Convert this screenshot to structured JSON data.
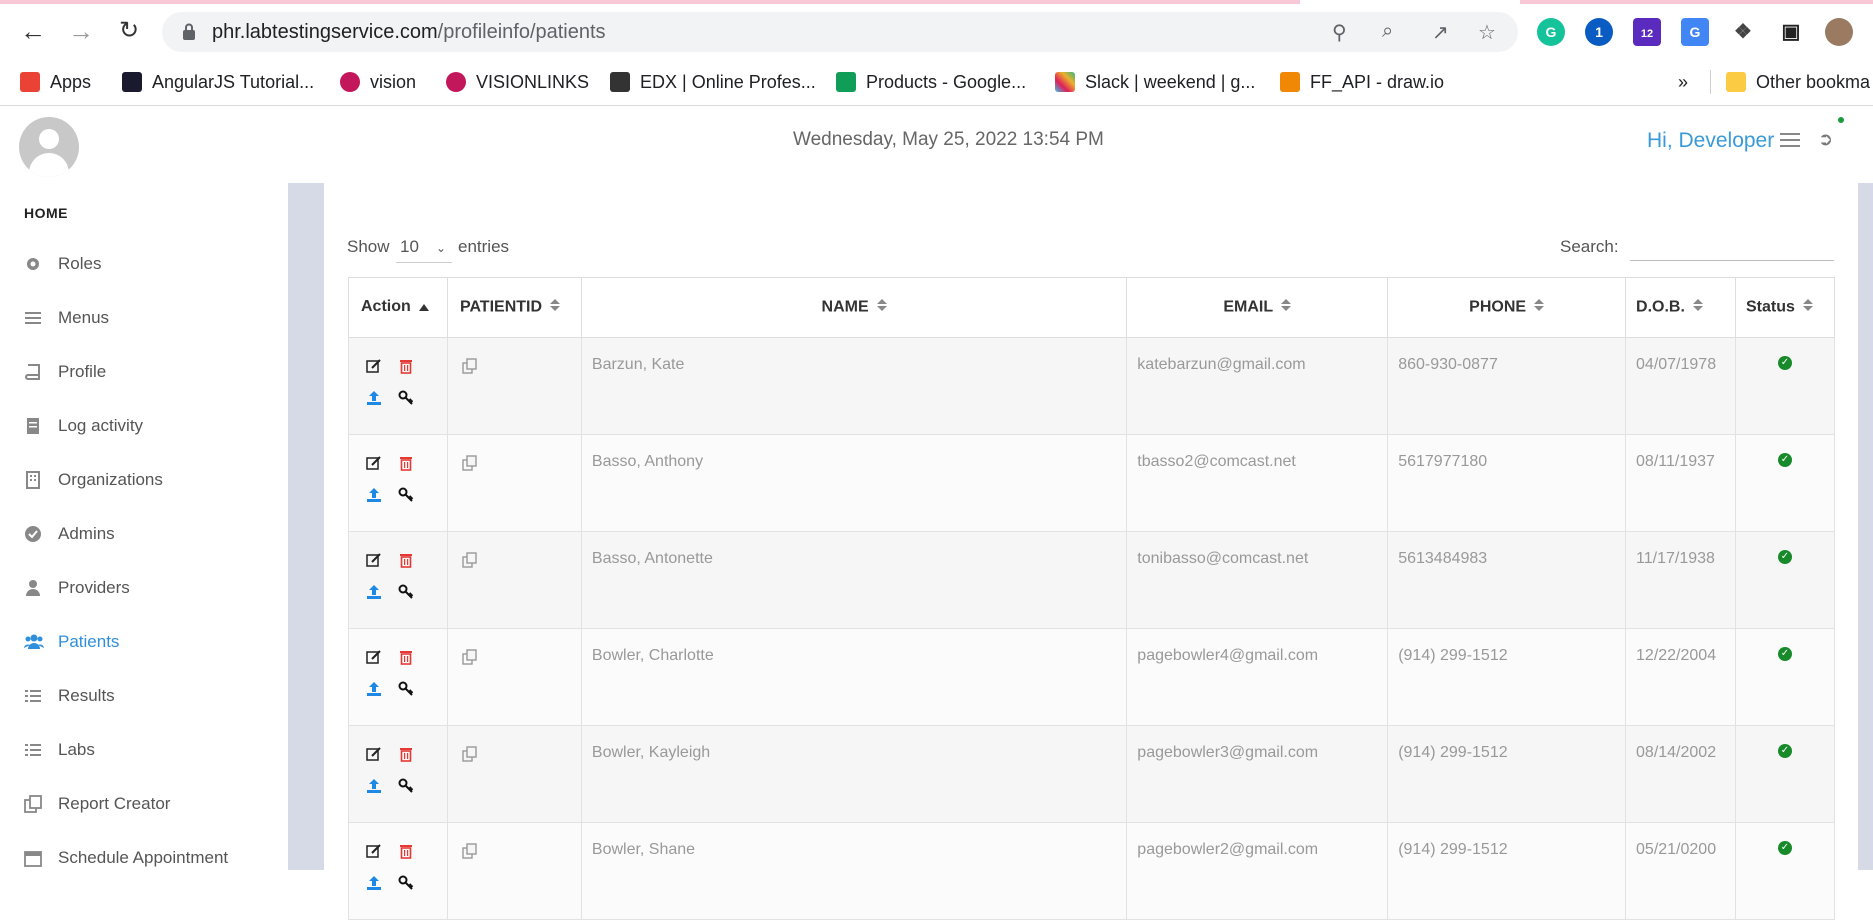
{
  "browser": {
    "url_domain": "phr.labtestingservice.com",
    "url_path": "/profileinfo/patients",
    "extension_badge": "12",
    "bookmarks": [
      {
        "label": "Apps",
        "color": "#ea4335"
      },
      {
        "label": "AngularJS Tutorial...",
        "color": "#1a1a2e"
      },
      {
        "label": "vision",
        "color": "#c2185b"
      },
      {
        "label": "VISIONLINKS",
        "color": "#c2185b"
      },
      {
        "label": "EDX | Online Profes...",
        "color": "#333333"
      },
      {
        "label": "Products - Google...",
        "color": "#0f9d58"
      },
      {
        "label": "Slack | weekend | g...",
        "color": "#4a154b"
      },
      {
        "label": "FF_API - draw.io",
        "color": "#f08705"
      }
    ],
    "more_bookmarks": "»",
    "other_bookmarks": "Other bookma"
  },
  "header": {
    "datetime": "Wednesday, May 25, 2022 13:54 PM",
    "greeting": "Hi, Developer"
  },
  "sidebar": {
    "home_label": "HOME",
    "items": [
      {
        "label": "Roles",
        "icon": "gear-icon"
      },
      {
        "label": "Menus",
        "icon": "menu-icon"
      },
      {
        "label": "Profile",
        "icon": "book-icon"
      },
      {
        "label": "Log activity",
        "icon": "document-icon"
      },
      {
        "label": "Organizations",
        "icon": "building-icon"
      },
      {
        "label": "Admins",
        "icon": "check-circle-icon"
      },
      {
        "label": "Providers",
        "icon": "user-md-icon"
      },
      {
        "label": "Patients",
        "icon": "users-icon",
        "active": true
      },
      {
        "label": "Results",
        "icon": "list-icon"
      },
      {
        "label": "Labs",
        "icon": "list-icon"
      },
      {
        "label": "Report Creator",
        "icon": "copy-icon"
      },
      {
        "label": "Schedule Appointment",
        "icon": "calendar-icon"
      }
    ]
  },
  "table_controls": {
    "show_label": "Show",
    "show_value": "10",
    "entries_label": "entries",
    "search_label": "Search:"
  },
  "table": {
    "headers": [
      "Action",
      "PATIENTID",
      "NAME",
      "EMAIL",
      "PHONE",
      "D.O.B.",
      "Status"
    ],
    "rows": [
      {
        "name": "Barzun, Kate",
        "email": "katebarzun@gmail.com",
        "phone": "860-930-0877",
        "dob": "04/07/1978"
      },
      {
        "name": "Basso, Anthony",
        "email": "tbasso2@comcast.net",
        "phone": "5617977180",
        "dob": "08/11/1937"
      },
      {
        "name": "Basso, Antonette",
        "email": "tonibasso@comcast.net",
        "phone": "5613484983",
        "dob": "11/17/1938"
      },
      {
        "name": "Bowler, Charlotte",
        "email": "pagebowler4@gmail.com",
        "phone": "(914) 299-1512",
        "dob": "12/22/2004"
      },
      {
        "name": "Bowler, Kayleigh",
        "email": "pagebowler3@gmail.com",
        "phone": "(914) 299-1512",
        "dob": "08/14/2002"
      },
      {
        "name": "Bowler, Shane",
        "email": "pagebowler2@gmail.com",
        "phone": "(914) 299-1512",
        "dob": "05/21/0200"
      }
    ]
  },
  "colors": {
    "accent": "#2f8fdc",
    "status_active": "#178a2a",
    "delete": "#e53935",
    "upload": "#1e88e5"
  }
}
